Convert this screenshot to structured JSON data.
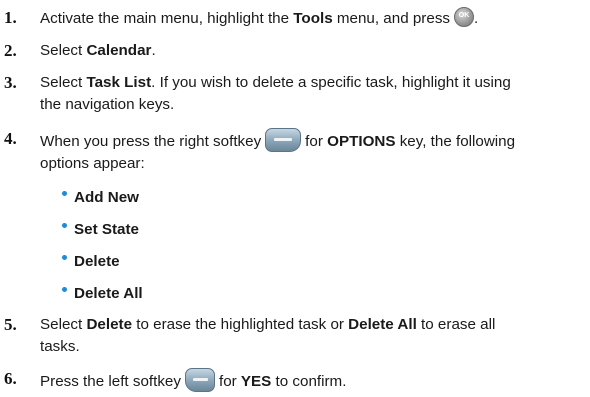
{
  "steps": [
    {
      "number": "1.",
      "a": "Activate the main menu, highlight the ",
      "b": "Tools",
      "c": " menu, and press",
      "d": "."
    },
    {
      "number": "2.",
      "a": "Select ",
      "b": "Calendar",
      "c": "."
    },
    {
      "number": "3.",
      "a": "Select ",
      "b": "Task List",
      "c": ". If you wish to delete a specific task, highlight it using",
      "line2": "the navigation keys."
    },
    {
      "number": "4.",
      "a": "When you press the right softkey",
      "b": "for ",
      "c": "OPTIONS",
      "d": " key, the following",
      "line2": "options appear:"
    },
    {
      "number": "5.",
      "a": "Select ",
      "b": "Delete",
      "c": " to erase the highlighted task or ",
      "d": "Delete All",
      "e": " to erase all",
      "line2": "tasks."
    },
    {
      "number": "6.",
      "a": "Press the left softkey",
      "b": "for ",
      "c": "YES",
      "d": " to confirm."
    }
  ],
  "options": [
    "Add New",
    "Set State",
    "Delete",
    "Delete All"
  ],
  "icons": {
    "ok_label": "OK",
    "bullet_color": "#1f8ad8",
    "softkey_color": "#8aa4b8"
  }
}
